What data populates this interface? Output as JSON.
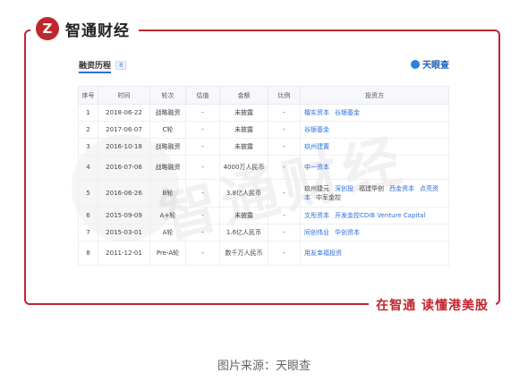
{
  "brand": {
    "logo_text": "Z",
    "name": "智通财经"
  },
  "slogan": "在智通 读懂港美股",
  "watermark": "智通财经",
  "section": {
    "title": "融资历程",
    "count": "8"
  },
  "source_logo": "天眼查",
  "table": {
    "headers": [
      "序号",
      "时间",
      "轮次",
      "估值",
      "金额",
      "比例",
      "投资方"
    ],
    "rows": [
      {
        "no": "1",
        "date": "2018-06-22",
        "round": "战略融资",
        "valuation": "-",
        "amount": "未披露",
        "ratio": "-",
        "investors": [
          {
            "name": "檀实资本",
            "link": true
          },
          {
            "name": "谷银基金",
            "link": true
          }
        ]
      },
      {
        "no": "2",
        "date": "2017-06-07",
        "round": "C轮",
        "valuation": "-",
        "amount": "未披露",
        "ratio": "-",
        "investors": [
          {
            "name": "谷银基金",
            "link": true
          }
        ]
      },
      {
        "no": "3",
        "date": "2016-10-18",
        "round": "战略融资",
        "valuation": "-",
        "amount": "未披露",
        "ratio": "-",
        "investors": [
          {
            "name": "玖州建置",
            "link": true
          }
        ]
      },
      {
        "no": "4",
        "date": "2016-07-06",
        "round": "战略融资",
        "valuation": "-",
        "amount": "4000万人民币",
        "ratio": "-",
        "investors": [
          {
            "name": "中一资本",
            "link": true
          }
        ]
      },
      {
        "no": "5",
        "date": "2016-06-26",
        "round": "B轮",
        "valuation": "-",
        "amount": "3.8亿人民币",
        "ratio": "-",
        "investors": [
          {
            "name": "玖州捷元",
            "link": false
          },
          {
            "name": "深创投",
            "link": true
          },
          {
            "name": "福建华创",
            "link": false
          },
          {
            "name": "西金资本",
            "link": true
          },
          {
            "name": "点亮资本",
            "link": true
          },
          {
            "name": "中军金控",
            "link": false
          }
        ]
      },
      {
        "no": "6",
        "date": "2015-09-09",
        "round": "A+轮",
        "valuation": "-",
        "amount": "未披露",
        "ratio": "-",
        "investors": [
          {
            "name": "文彤资本",
            "link": true
          },
          {
            "name": "开发金控CDIB Venture Capital",
            "link": true
          }
        ]
      },
      {
        "no": "7",
        "date": "2015-03-01",
        "round": "A轮",
        "valuation": "-",
        "amount": "1.6亿人民币",
        "ratio": "-",
        "investors": [
          {
            "name": "同创伟业",
            "link": true
          },
          {
            "name": "华创资本",
            "link": true
          }
        ]
      },
      {
        "no": "8",
        "date": "2011-12-01",
        "round": "Pre-A轮",
        "valuation": "-",
        "amount": "数千万人民币",
        "ratio": "-",
        "investors": [
          {
            "name": "用友幸福投资",
            "link": true
          }
        ]
      }
    ]
  },
  "caption": "图片来源：天眼查"
}
